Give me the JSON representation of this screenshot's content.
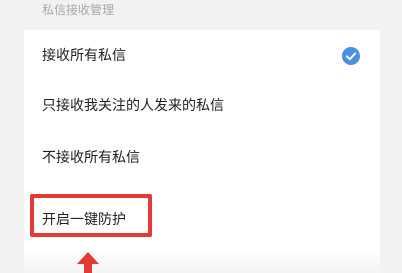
{
  "section": {
    "title": "私信接收管理"
  },
  "options": [
    {
      "label": "接收所有私信",
      "selected": true
    },
    {
      "label": "只接收我关注的人发来的私信",
      "selected": false
    },
    {
      "label": "不接收所有私信",
      "selected": false
    },
    {
      "label": "开启一键防护",
      "selected": false
    }
  ],
  "icons": {
    "check": "check-circle-icon",
    "annotation_arrow": "arrow-up-icon"
  },
  "colors": {
    "accent": "#4a90e2",
    "annotation": "#e53935",
    "background": "#f2f2f2",
    "card": "#ffffff"
  }
}
